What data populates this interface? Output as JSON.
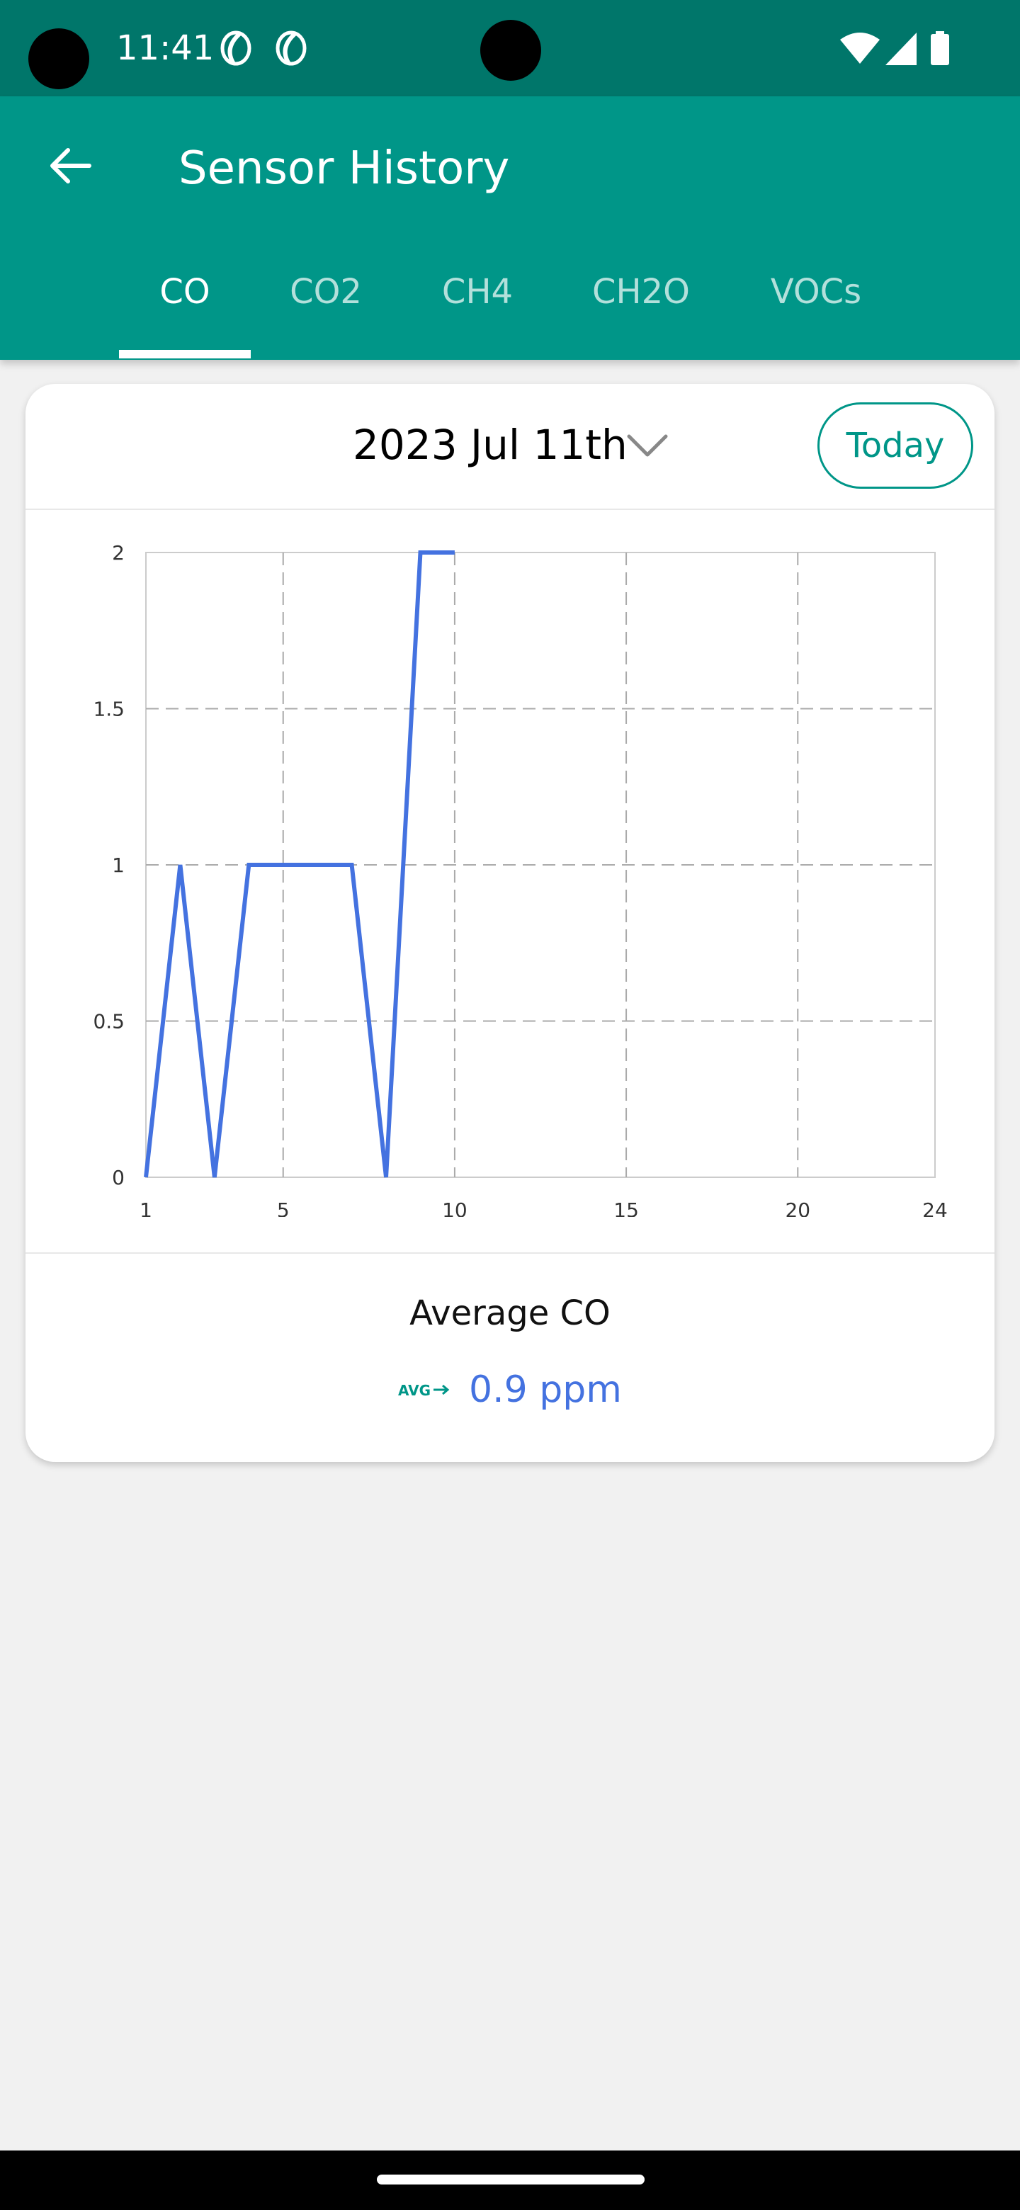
{
  "status_bar": {
    "time": "11:41",
    "icons": [
      "leaf-notification-icon",
      "leaf-notification-icon",
      "wifi-icon",
      "cell-signal-icon",
      "battery-icon"
    ]
  },
  "app_bar": {
    "title": "Sensor History",
    "back_icon": "arrow-back-icon",
    "tabs": [
      {
        "label": "CO",
        "selected": true
      },
      {
        "label": "CO2",
        "selected": false
      },
      {
        "label": "CH4",
        "selected": false
      },
      {
        "label": "CH2O",
        "selected": false
      },
      {
        "label": "VOCs",
        "selected": false
      }
    ]
  },
  "card": {
    "date": "2023 Jul 11th",
    "dropdown_icon": "chevron-down-icon",
    "today_label": "Today",
    "avg_title": "Average CO",
    "avg_icon": "avg-arrow-icon",
    "avg_icon_text": "AVG",
    "avg_value": "0.9 ppm"
  },
  "colors": {
    "status_bar": "#00766a",
    "primary": "#009688",
    "line": "#4472e0",
    "background": "#f1f1f1"
  },
  "chart_data": {
    "type": "line",
    "x": [
      1,
      2,
      3,
      4,
      5,
      6,
      7,
      8,
      9,
      10
    ],
    "series": [
      {
        "values": [
          0,
          1,
          0,
          1,
          1,
          1,
          1,
          0,
          2,
          2
        ]
      }
    ],
    "xlim": [
      1,
      24
    ],
    "ylim": [
      0,
      2
    ],
    "x_ticks": [
      1,
      5,
      10,
      15,
      20,
      24
    ],
    "x_tick_labels": [
      "1",
      "5",
      "10",
      "15",
      "20",
      "24"
    ],
    "y_ticks": [
      0,
      0.5,
      1,
      1.5,
      2
    ],
    "y_tick_labels": [
      "0",
      "0.5",
      "1",
      "1.5",
      "2"
    ],
    "vertical_gridlines_at": [
      5,
      10,
      15,
      20
    ],
    "horizontal_gridlines_at": [
      0.5,
      1,
      1.5
    ],
    "grid": true,
    "grid_style": "dashed",
    "title": "",
    "xlabel": "",
    "ylabel": ""
  }
}
